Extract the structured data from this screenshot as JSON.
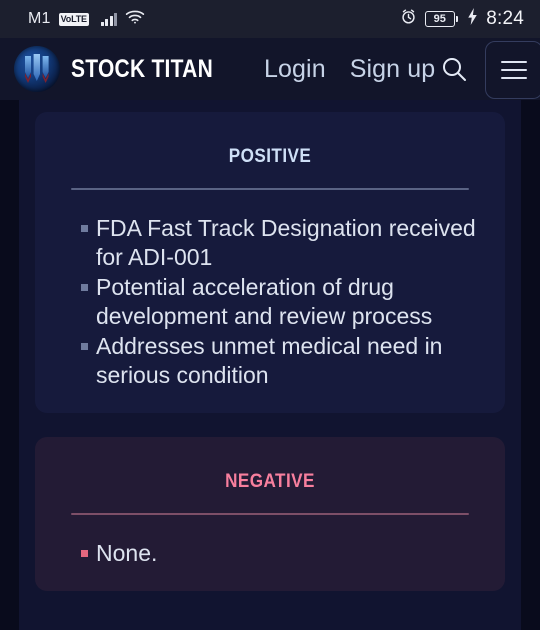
{
  "status_bar": {
    "carrier": "M1",
    "network_badge": "VoLTE",
    "signal_icon": "signal-bars-icon",
    "wifi_icon": "wifi-icon",
    "alarm_icon": "alarm-clock-icon",
    "battery_percent": "95",
    "charging_icon": "charging-bolt-icon",
    "time": "8:24"
  },
  "header": {
    "logo_icon": "stock-titan-logo-icon",
    "brand": "STOCK TITAN",
    "login_label": "Login",
    "signup_label": "Sign up",
    "search_icon": "search-icon",
    "menu_icon": "hamburger-menu-icon"
  },
  "colors": {
    "page_bg": "#090b1c",
    "content_bg": "#111430",
    "positive_card_bg": "#161a3c",
    "negative_card_bg": "#231b35",
    "positive_title": "#cfe0f7",
    "negative_title": "#f87f9e",
    "positive_rule": "#5a6384",
    "negative_rule": "#7d4f68",
    "positive_bullet": "#6f7b9e",
    "negative_bullet": "#e4677f",
    "body_text": "#dde3ef",
    "nav_text": "#c7d3e7"
  },
  "cards": {
    "positive": {
      "title": "Positive",
      "items": [
        "FDA Fast Track Designation received for ADI-001",
        "Potential acceleration of drug development and review process",
        "Addresses unmet medical need in serious condition"
      ]
    },
    "negative": {
      "title": "Negative",
      "items": [
        "None."
      ]
    }
  }
}
